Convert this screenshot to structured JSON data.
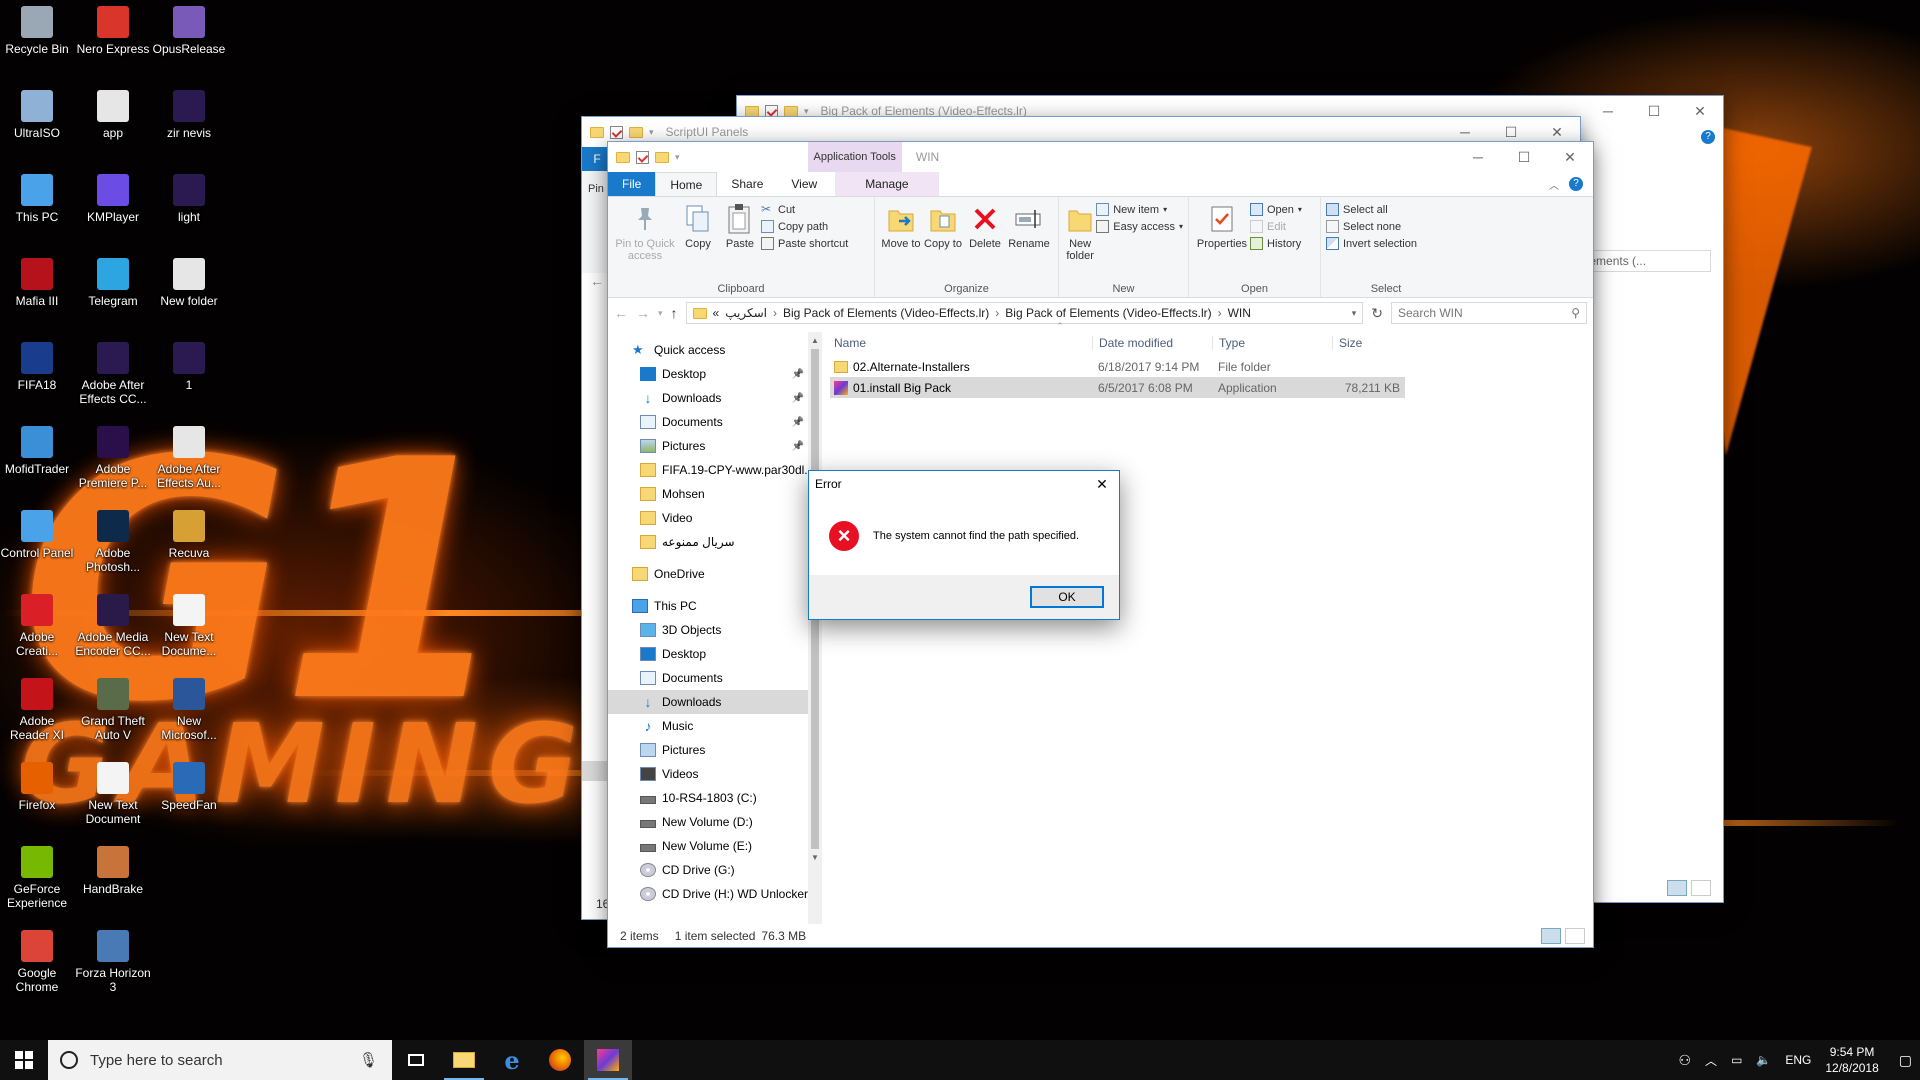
{
  "desktop": {
    "icons": [
      {
        "label": "Recycle Bin",
        "icon": "recycle-bin-icon",
        "color": "#9aa7b5"
      },
      {
        "label": "Nero Express",
        "icon": "nero-icon",
        "color": "#d9352b"
      },
      {
        "label": "OpusRelease",
        "icon": "opus-icon",
        "color": "#7a5ab8"
      },
      {
        "label": "UltraISO",
        "icon": "ultraiso-icon",
        "color": "#8fb1d6"
      },
      {
        "label": "app",
        "icon": "file-icon",
        "color": "#e6e6e6"
      },
      {
        "label": "zir nevis",
        "icon": "after-effects-icon",
        "color": "#2b1a52"
      },
      {
        "label": "This PC",
        "icon": "computer-icon",
        "color": "#4aa3e8"
      },
      {
        "label": "KMPlayer",
        "icon": "kmplayer-icon",
        "color": "#6b4de6"
      },
      {
        "label": "light",
        "icon": "after-effects-icon",
        "color": "#2b1a52"
      },
      {
        "label": "Mafia III",
        "icon": "mafia-icon",
        "color": "#b5121b"
      },
      {
        "label": "Telegram",
        "icon": "telegram-icon",
        "color": "#2ca5e0"
      },
      {
        "label": "New folder",
        "icon": "file-icon",
        "color": "#e6e6e6"
      },
      {
        "label": "FIFA18",
        "icon": "fifa-icon",
        "color": "#1a3c8c"
      },
      {
        "label": "Adobe After Effects CC...",
        "icon": "after-effects-icon",
        "color": "#2b1a52"
      },
      {
        "label": "1",
        "icon": "after-effects-icon",
        "color": "#2b1a52"
      },
      {
        "label": "MofidTrader",
        "icon": "mofid-icon",
        "color": "#3a8fd6"
      },
      {
        "label": "Adobe Premiere P...",
        "icon": "premiere-icon",
        "color": "#2a0f4a"
      },
      {
        "label": "Adobe After Effects Au...",
        "icon": "file-icon",
        "color": "#e6e6e6"
      },
      {
        "label": "Control Panel",
        "icon": "control-panel-icon",
        "color": "#4aa3e8"
      },
      {
        "label": "Adobe Photosh...",
        "icon": "photoshop-icon",
        "color": "#0d2a4a"
      },
      {
        "label": "Recuva",
        "icon": "recuva-icon",
        "color": "#d6a035"
      },
      {
        "label": "Adobe Creati...",
        "icon": "creative-cloud-icon",
        "color": "#da1f26"
      },
      {
        "label": "Adobe Media Encoder CC...",
        "icon": "media-encoder-icon",
        "color": "#2a1a4a"
      },
      {
        "label": "New Text Docume...",
        "icon": "text-document-icon",
        "color": "#f4f4f4"
      },
      {
        "label": "Adobe Reader XI",
        "icon": "acrobat-icon",
        "color": "#c4141a"
      },
      {
        "label": "Grand Theft Auto V",
        "icon": "gta-icon",
        "color": "#5a6b4a"
      },
      {
        "label": "New Microsof...",
        "icon": "word-icon",
        "color": "#2b579a"
      },
      {
        "label": "Firefox",
        "icon": "firefox-icon",
        "color": "#e66000"
      },
      {
        "label": "New Text Document",
        "icon": "text-document-icon",
        "color": "#f4f4f4"
      },
      {
        "label": "SpeedFan",
        "icon": "speedfan-icon",
        "color": "#2a6bb8"
      },
      {
        "label": "GeForce Experience",
        "icon": "geforce-icon",
        "color": "#76b900"
      },
      {
        "label": "HandBrake",
        "icon": "handbrake-icon",
        "color": "#c8733a"
      },
      {
        "label": "",
        "icon": "",
        "color": ""
      },
      {
        "label": "Google Chrome",
        "icon": "chrome-icon",
        "color": "#db4437"
      },
      {
        "label": "Forza Horizon 3",
        "icon": "forza-icon",
        "color": "#4a7ab5"
      }
    ]
  },
  "back_window": {
    "title": "Big Pack of Elements (Video-Effects.lr)",
    "address_fragment": "k of Elements (...",
    "help": "?"
  },
  "mid_window": {
    "title": "ScriptUI Panels",
    "tab_fragment": "F",
    "ribbon_fragment": "Pin",
    "status_fragment": "16"
  },
  "explorer": {
    "title": "WIN",
    "context_tab": "Application Tools",
    "tabs": [
      "File",
      "Home",
      "Share",
      "View",
      "Manage"
    ],
    "ribbon": {
      "clipboard": {
        "label": "Clipboard",
        "pin": "Pin to Quick access",
        "copy": "Copy",
        "paste": "Paste",
        "cut": "Cut",
        "copy_path": "Copy path",
        "paste_shortcut": "Paste shortcut"
      },
      "organize": {
        "label": "Organize",
        "move_to": "Move to",
        "copy_to": "Copy to",
        "delete": "Delete",
        "rename": "Rename"
      },
      "new": {
        "label": "New",
        "new_folder": "New folder",
        "new_item": "New item",
        "easy_access": "Easy access"
      },
      "open": {
        "label": "Open",
        "properties": "Properties",
        "open": "Open",
        "edit": "Edit",
        "history": "History"
      },
      "select": {
        "label": "Select",
        "select_all": "Select all",
        "select_none": "Select none",
        "invert": "Invert selection"
      }
    },
    "address": {
      "overflow": "«",
      "segments": [
        "اسکریپ",
        "Big Pack of Elements (Video-Effects.lr)",
        "Big Pack of Elements (Video-Effects.lr)",
        "WIN"
      ]
    },
    "search_placeholder": "Search WIN",
    "nav": {
      "quick_access": {
        "label": "Quick access",
        "items": [
          {
            "label": "Desktop",
            "pinned": true
          },
          {
            "label": "Downloads",
            "pinned": true
          },
          {
            "label": "Documents",
            "pinned": true
          },
          {
            "label": "Pictures",
            "pinned": true
          },
          {
            "label": "FIFA.19-CPY-www.par30dl.c",
            "pinned": false
          },
          {
            "label": "Mohsen",
            "pinned": false
          },
          {
            "label": "Video",
            "pinned": false
          },
          {
            "label": "سریال ممنوعه",
            "pinned": false
          }
        ]
      },
      "onedrive": "OneDrive",
      "this_pc": {
        "label": "This PC",
        "items": [
          "3D Objects",
          "Desktop",
          "Documents",
          "Downloads",
          "Music",
          "Pictures",
          "Videos",
          "10-RS4-1803 (C:)",
          "New Volume (D:)",
          "New Volume (E:)",
          "CD Drive (G:)",
          "CD Drive (H:) WD Unlocker"
        ]
      }
    },
    "columns": [
      "Name",
      "Date modified",
      "Type",
      "Size"
    ],
    "files": [
      {
        "name": "02.Alternate-Installers",
        "date": "6/18/2017 9:14 PM",
        "type": "File folder",
        "size": "",
        "selected": false
      },
      {
        "name": "01.install Big Pack",
        "date": "6/5/2017 6:08 PM",
        "type": "Application",
        "size": "78,211 KB",
        "selected": true
      }
    ],
    "status": {
      "count": "2 items",
      "selected": "1 item selected",
      "size": "76.3 MB"
    }
  },
  "dialog": {
    "title": "Error",
    "message": "The system cannot find the path specified.",
    "ok": "OK"
  },
  "taskbar": {
    "search_placeholder": "Type here to search",
    "language": "ENG",
    "time": "9:54 PM",
    "date": "12/8/2018"
  }
}
